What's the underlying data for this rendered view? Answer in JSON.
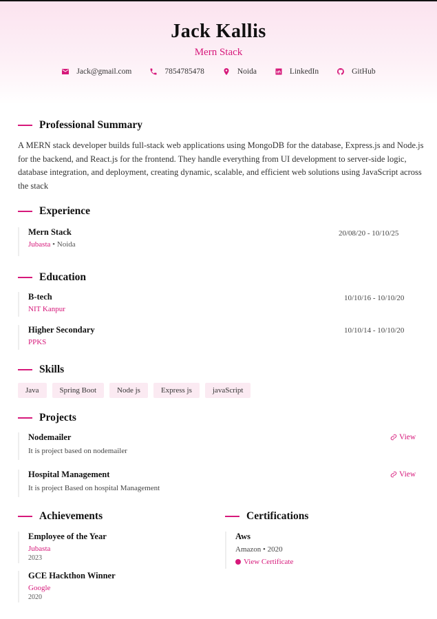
{
  "header": {
    "name": "Jack Kallis",
    "role": "Mern Stack",
    "contacts": {
      "email": "Jack@gmail.com",
      "phone": "7854785478",
      "location": "Noida",
      "linkedin": "LinkedIn",
      "github": "GitHub"
    }
  },
  "summary": {
    "title": "Professional Summary",
    "text": "A MERN stack developer builds full-stack web applications using MongoDB for the database, Express.js and Node.js for the backend, and React.js for the frontend. They handle everything from UI development to server-side logic, database integration, and deployment, creating dynamic, scalable, and efficient web solutions using JavaScript across the stack"
  },
  "experience": {
    "title": "Experience",
    "items": [
      {
        "role": "Mern Stack",
        "company": "Jubasta",
        "location": "Noida",
        "dates": "20/08/20 - 10/10/25"
      }
    ]
  },
  "education": {
    "title": "Education",
    "items": [
      {
        "degree": "B-tech",
        "school": "NIT Kanpur",
        "dates": "10/10/16 - 10/10/20"
      },
      {
        "degree": "Higher Secondary",
        "school": "PPKS",
        "dates": "10/10/14 - 10/10/20"
      }
    ]
  },
  "skills": {
    "title": "Skills",
    "items": [
      "Java",
      "Spring Boot",
      "Node js",
      "Express js",
      "javaScript"
    ]
  },
  "projects": {
    "title": "Projects",
    "view_label": "View",
    "items": [
      {
        "name": "Nodemailer",
        "description": "It is project based on nodemailer"
      },
      {
        "name": "Hospital Management",
        "description": "It is project Based on hospital Management"
      }
    ]
  },
  "achievements": {
    "title": "Achievements",
    "items": [
      {
        "title": "Employee of the Year",
        "org": "Jubasta",
        "year": "2023"
      },
      {
        "title": "GCE Hackthon Winner",
        "org": "Google",
        "year": "2020"
      }
    ]
  },
  "certifications": {
    "title": "Certifications",
    "items": [
      {
        "name": "Aws",
        "issuer": "Amazon",
        "year": "2020",
        "link_label": "View Certificate"
      }
    ]
  },
  "colors": {
    "accent": "#d6187a",
    "header_bg": "#fbe3ef"
  }
}
